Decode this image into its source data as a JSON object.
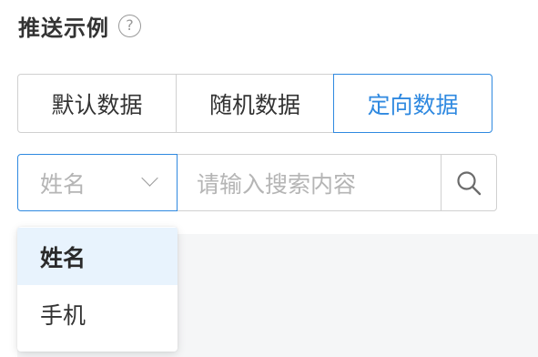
{
  "title": {
    "text": "推送示例",
    "help_icon": "question-circle-icon"
  },
  "segments": [
    {
      "label": "默认数据",
      "active": false
    },
    {
      "label": "随机数据",
      "active": false
    },
    {
      "label": "定向数据",
      "active": true
    }
  ],
  "search": {
    "field_select": {
      "value": "姓名",
      "icon": "chevron-down-icon"
    },
    "placeholder": "请输入搜索内容",
    "button_icon": "search-icon"
  },
  "dropdown": {
    "options": [
      {
        "label": "姓名",
        "selected": true
      },
      {
        "label": "手机",
        "selected": false
      }
    ]
  },
  "colors": {
    "accent": "#2f89e0",
    "border": "#d0d0d0",
    "placeholder": "#b5b5b5",
    "selected_bg": "#e8f3fd",
    "content_bg": "#f5f6f7"
  }
}
